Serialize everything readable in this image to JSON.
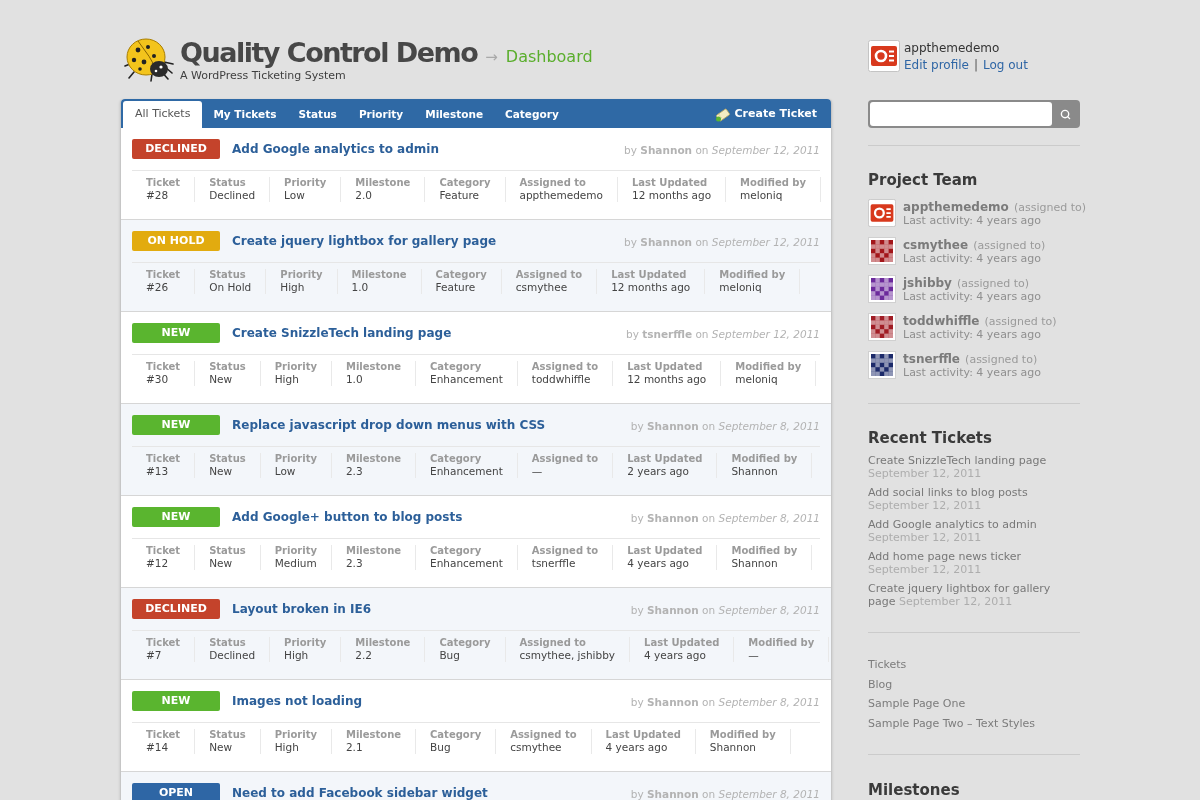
{
  "header": {
    "title": "Quality Control Demo",
    "arrow": "→",
    "section": "Dashboard",
    "tagline": "A WordPress Ticketing System"
  },
  "tabs": [
    {
      "label": "All Tickets",
      "selected": true
    },
    {
      "label": "My Tickets",
      "selected": false
    },
    {
      "label": "Status",
      "selected": false
    },
    {
      "label": "Priority",
      "selected": false
    },
    {
      "label": "Milestone",
      "selected": false
    },
    {
      "label": "Category",
      "selected": false
    }
  ],
  "create_ticket": {
    "label": "Create Ticket"
  },
  "tickets": [
    {
      "status": "DECLINED",
      "color": "#c4432b",
      "title": "Add Google analytics to admin",
      "byline": "by **Shannon** on *September 12, 2011*",
      "fields": [
        {
          "label": "Ticket",
          "value": "#28"
        },
        {
          "label": "Status",
          "value": "Declined"
        },
        {
          "label": "Priority",
          "value": "Low"
        },
        {
          "label": "Milestone",
          "value": "2.0"
        },
        {
          "label": "Category",
          "value": "Feature"
        },
        {
          "label": "Assigned to",
          "value": "appthemedemo"
        },
        {
          "label": "Last Updated",
          "value": "12 months ago"
        },
        {
          "label": "Modified by",
          "value": "meloniq"
        }
      ]
    },
    {
      "status": "ON HOLD",
      "color": "#e2ab0f",
      "title": "Create jquery lightbox for gallery page",
      "byline": "by **Shannon** on *September 12, 2011*",
      "fields": [
        {
          "label": "Ticket",
          "value": "#26"
        },
        {
          "label": "Status",
          "value": "On Hold"
        },
        {
          "label": "Priority",
          "value": "High"
        },
        {
          "label": "Milestone",
          "value": "1.0"
        },
        {
          "label": "Category",
          "value": "Feature"
        },
        {
          "label": "Assigned to",
          "value": "csmythee"
        },
        {
          "label": "Last Updated",
          "value": "12 months ago"
        },
        {
          "label": "Modified by",
          "value": "meloniq"
        }
      ]
    },
    {
      "status": "NEW",
      "color": "#5ab52f",
      "title": "Create SnizzleTech landing page",
      "byline": "by **tsnerffle** on *September 12, 2011*",
      "fields": [
        {
          "label": "Ticket",
          "value": "#30"
        },
        {
          "label": "Status",
          "value": "New"
        },
        {
          "label": "Priority",
          "value": "High"
        },
        {
          "label": "Milestone",
          "value": "1.0"
        },
        {
          "label": "Category",
          "value": "Enhancement"
        },
        {
          "label": "Assigned to",
          "value": "toddwhiffle"
        },
        {
          "label": "Last Updated",
          "value": "12 months ago"
        },
        {
          "label": "Modified by",
          "value": "meloniq"
        }
      ]
    },
    {
      "status": "NEW",
      "color": "#5ab52f",
      "title": "Replace javascript drop down menus with CSS",
      "byline": "by **Shannon** on *September 8, 2011*",
      "fields": [
        {
          "label": "Ticket",
          "value": "#13"
        },
        {
          "label": "Status",
          "value": "New"
        },
        {
          "label": "Priority",
          "value": "Low"
        },
        {
          "label": "Milestone",
          "value": "2.3"
        },
        {
          "label": "Category",
          "value": "Enhancement"
        },
        {
          "label": "Assigned to",
          "value": "—"
        },
        {
          "label": "Last Updated",
          "value": "2 years ago"
        },
        {
          "label": "Modified by",
          "value": "Shannon"
        }
      ]
    },
    {
      "status": "NEW",
      "color": "#5ab52f",
      "title": "Add Google+ button to blog posts",
      "byline": "by **Shannon** on *September 8, 2011*",
      "fields": [
        {
          "label": "Ticket",
          "value": "#12"
        },
        {
          "label": "Status",
          "value": "New"
        },
        {
          "label": "Priority",
          "value": "Medium"
        },
        {
          "label": "Milestone",
          "value": "2.3"
        },
        {
          "label": "Category",
          "value": "Enhancement"
        },
        {
          "label": "Assigned to",
          "value": "tsnerffle"
        },
        {
          "label": "Last Updated",
          "value": "4 years ago"
        },
        {
          "label": "Modified by",
          "value": "Shannon"
        }
      ]
    },
    {
      "status": "DECLINED",
      "color": "#c4432b",
      "title": "Layout broken in IE6",
      "byline": "by **Shannon** on *September 8, 2011*",
      "fields": [
        {
          "label": "Ticket",
          "value": "#7"
        },
        {
          "label": "Status",
          "value": "Declined"
        },
        {
          "label": "Priority",
          "value": "High"
        },
        {
          "label": "Milestone",
          "value": "2.2"
        },
        {
          "label": "Category",
          "value": "Bug"
        },
        {
          "label": "Assigned to",
          "value": "csmythee, jshibby"
        },
        {
          "label": "Last Updated",
          "value": "4 years ago"
        },
        {
          "label": "Modified by",
          "value": "—"
        }
      ]
    },
    {
      "status": "NEW",
      "color": "#5ab52f",
      "title": "Images not loading",
      "byline": "by **Shannon** on *September 8, 2011*",
      "fields": [
        {
          "label": "Ticket",
          "value": "#14"
        },
        {
          "label": "Status",
          "value": "New"
        },
        {
          "label": "Priority",
          "value": "High"
        },
        {
          "label": "Milestone",
          "value": "2.1"
        },
        {
          "label": "Category",
          "value": "Bug"
        },
        {
          "label": "Assigned to",
          "value": "csmythee"
        },
        {
          "label": "Last Updated",
          "value": "4 years ago"
        },
        {
          "label": "Modified by",
          "value": "Shannon"
        }
      ]
    },
    {
      "status": "OPEN",
      "color": "#2e66a5",
      "title": "Need to add Facebook sidebar widget",
      "byline": "by **Shannon** on *September 8, 2011*"
    }
  ],
  "account": {
    "username": "appthemedemo",
    "links": [
      "Edit profile",
      "Log out"
    ],
    "separator": "|"
  },
  "project_team": {
    "title": "Project Team",
    "members": [
      {
        "name": "appthemedemo",
        "role": "(assigned to)",
        "activity": "Last activity: 4 years ago",
        "kind": "logo"
      },
      {
        "name": "csmythee",
        "role": "(assigned to)",
        "activity": "Last activity: 4 years ago",
        "kind": "identicon",
        "color": "#a3161a"
      },
      {
        "name": "jshibby",
        "role": "(assigned to)",
        "activity": "Last activity: 4 years ago",
        "kind": "identicon",
        "color": "#6c2a9c"
      },
      {
        "name": "toddwhiffle",
        "role": "(assigned to)",
        "activity": "Last activity: 4 years ago",
        "kind": "identicon",
        "color": "#a01c24"
      },
      {
        "name": "tsnerffle",
        "role": "(assigned to)",
        "activity": "Last activity: 4 years ago",
        "kind": "identicon",
        "color": "#1c2a6a"
      }
    ]
  },
  "recent_tickets": {
    "title": "Recent Tickets",
    "items": [
      {
        "title": "Create SnizzleTech landing page",
        "date": "September 12, 2011"
      },
      {
        "title": "Add social links to blog posts",
        "date": "September 12, 2011"
      },
      {
        "title": "Add Google analytics to admin",
        "date": "September 12, 2011"
      },
      {
        "title": "Add home page news ticker",
        "date": "September 12, 2011"
      },
      {
        "title": "Create jquery lightbox for gallery page",
        "date": "September 12, 2011"
      }
    ]
  },
  "pages": [
    "Tickets",
    "Blog",
    "Sample Page One",
    "Sample Page Two – Text Styles"
  ],
  "milestones": {
    "title": "Milestones"
  }
}
